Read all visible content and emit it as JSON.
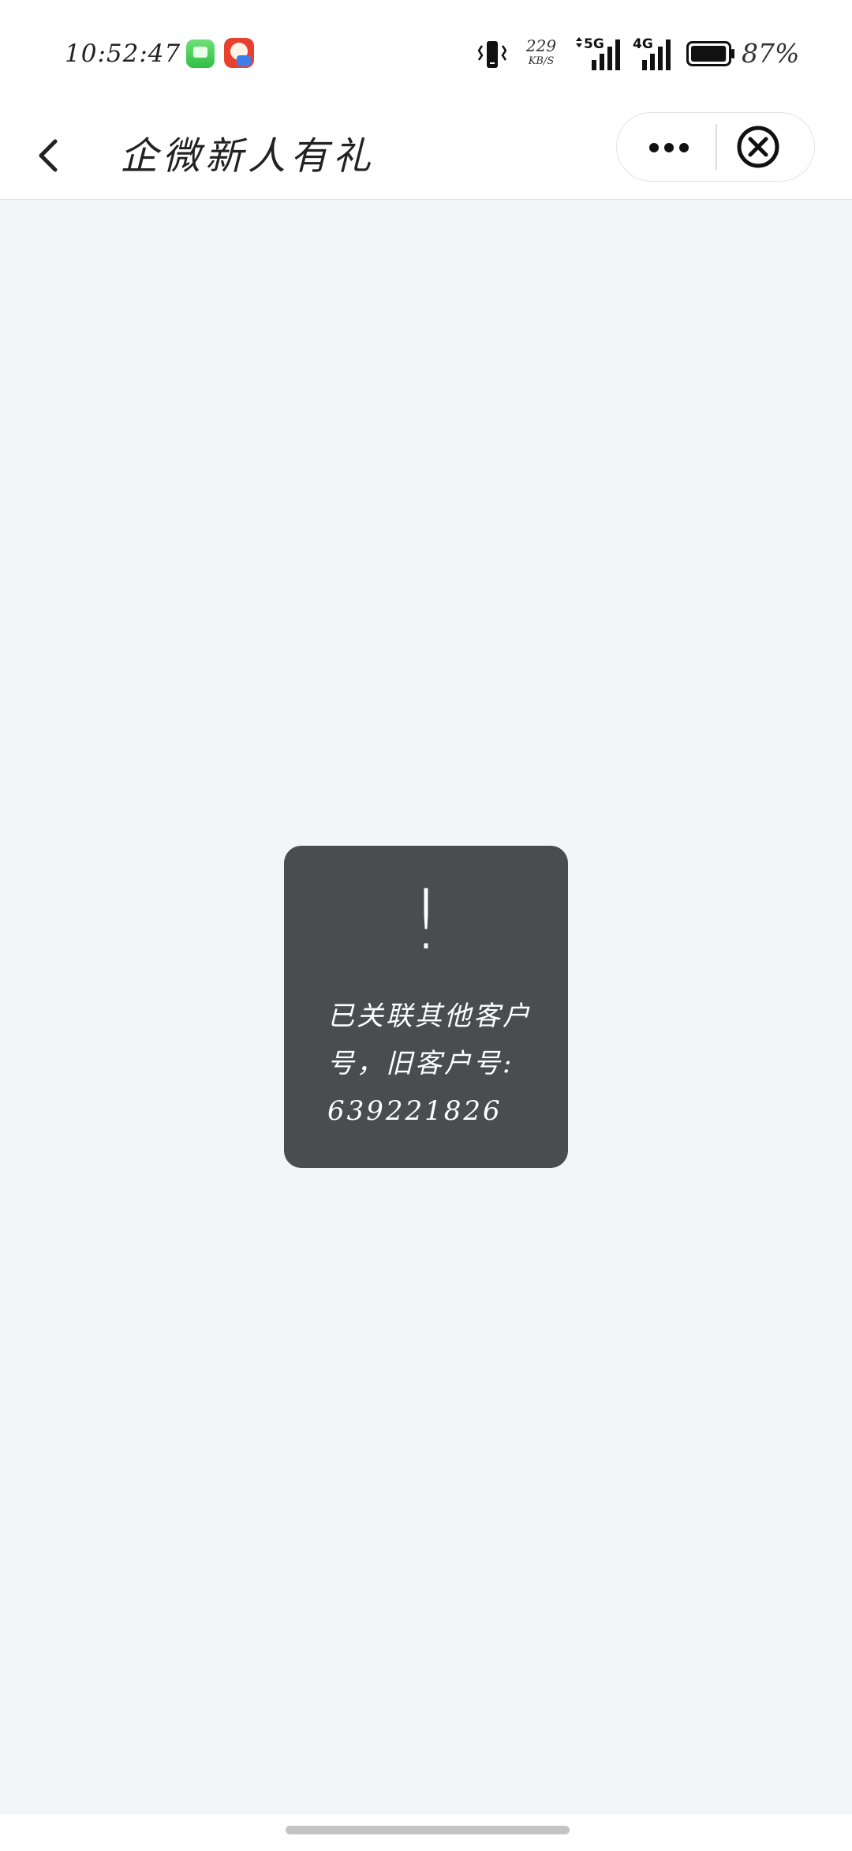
{
  "status_bar": {
    "time": "10:52:47",
    "net_speed_value": "229",
    "net_speed_unit": "KB/S",
    "signal_1_label": "5G",
    "signal_2_label": "4G",
    "battery_percent": "87%",
    "battery_level": 0.87,
    "notification_icons": [
      "messages-app-icon",
      "game-app-icon"
    ]
  },
  "nav": {
    "title": "企微新人有礼",
    "back_icon": "chevron-left-icon",
    "more_icon": "more-dots-icon",
    "close_icon": "close-circle-icon"
  },
  "toast": {
    "icon_glyph": "!",
    "message": "已关联其他客户号，旧客户号: 639221826"
  },
  "colors": {
    "page_background": "#f4f5f9",
    "toast_background": "#4b4c4e",
    "toast_text": "#ffffff"
  }
}
